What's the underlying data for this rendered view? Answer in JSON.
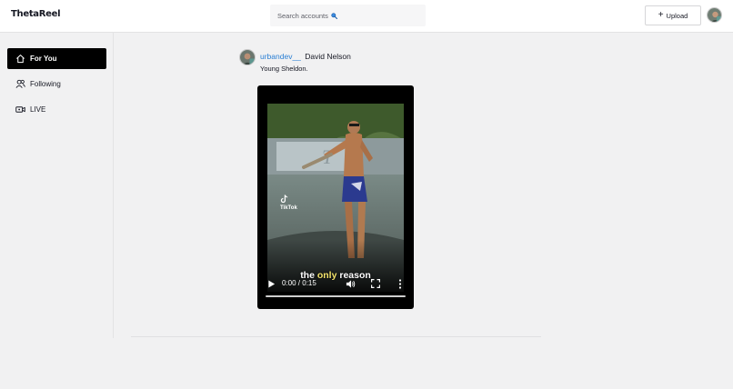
{
  "header": {
    "logo": "ThetaReel",
    "search_placeholder": "Search accounts",
    "upload_label": "Upload"
  },
  "sidebar": {
    "items": [
      {
        "label": "For You",
        "icon": "home-icon",
        "active": true
      },
      {
        "label": "Following",
        "icon": "following-icon",
        "active": false
      },
      {
        "label": "LIVE",
        "icon": "live-camera-icon",
        "active": false
      }
    ]
  },
  "post": {
    "username": "urbandev__",
    "display_name": "David Nelson",
    "caption": "Young Sheldon.",
    "video": {
      "watermark": "TikTok",
      "subtitle_pre": "the",
      "subtitle_highlight": "only",
      "subtitle_post": "reason",
      "time": "0:00 / 0:15",
      "progress": 0
    }
  },
  "colors": {
    "accent_link": "#2a7fd4",
    "active_nav_bg": "#000000",
    "page_bg": "#f1f1f2"
  }
}
